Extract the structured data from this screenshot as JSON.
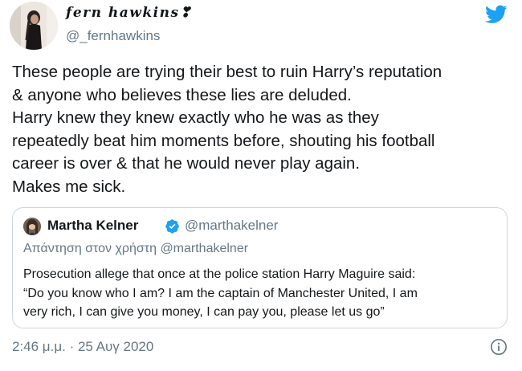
{
  "author": {
    "display_name": "fern hawkins❣",
    "handle": "@_fernhawkins",
    "avatar": "avatar-photo"
  },
  "brand_icon": "twitter-bird-icon",
  "colors": {
    "text": "#14171a",
    "secondary": "#657786",
    "twitter_blue": "#1da1f2",
    "border": "#ccd6dd"
  },
  "tweet": {
    "lines": [
      "These people are trying their best to ruin Harry’s reputation",
      "& anyone who believes these lies are deluded.",
      "Harry knew they knew exactly who he was as they",
      "repeatedly beat him moments before, shouting his football",
      "career is over & that he would never play again.",
      "Makes me sick."
    ],
    "timestamp": "2:46 μ.μ. · 25 Αυγ 2020"
  },
  "quote": {
    "name": "Martha Kelner",
    "verified_icon": "verified-badge-icon",
    "handle": "@marthakelner",
    "reply_prefix": "Απάντηση στον χρήστη",
    "reply_mention": "@marthakelner",
    "lines": [
      "Prosecution allege that once at the police station Harry Maguire said:",
      "“Do you know who I am? I am the captain of Manchester United, I am",
      "very rich, I can give you money, I can pay you, please let us go”"
    ]
  }
}
